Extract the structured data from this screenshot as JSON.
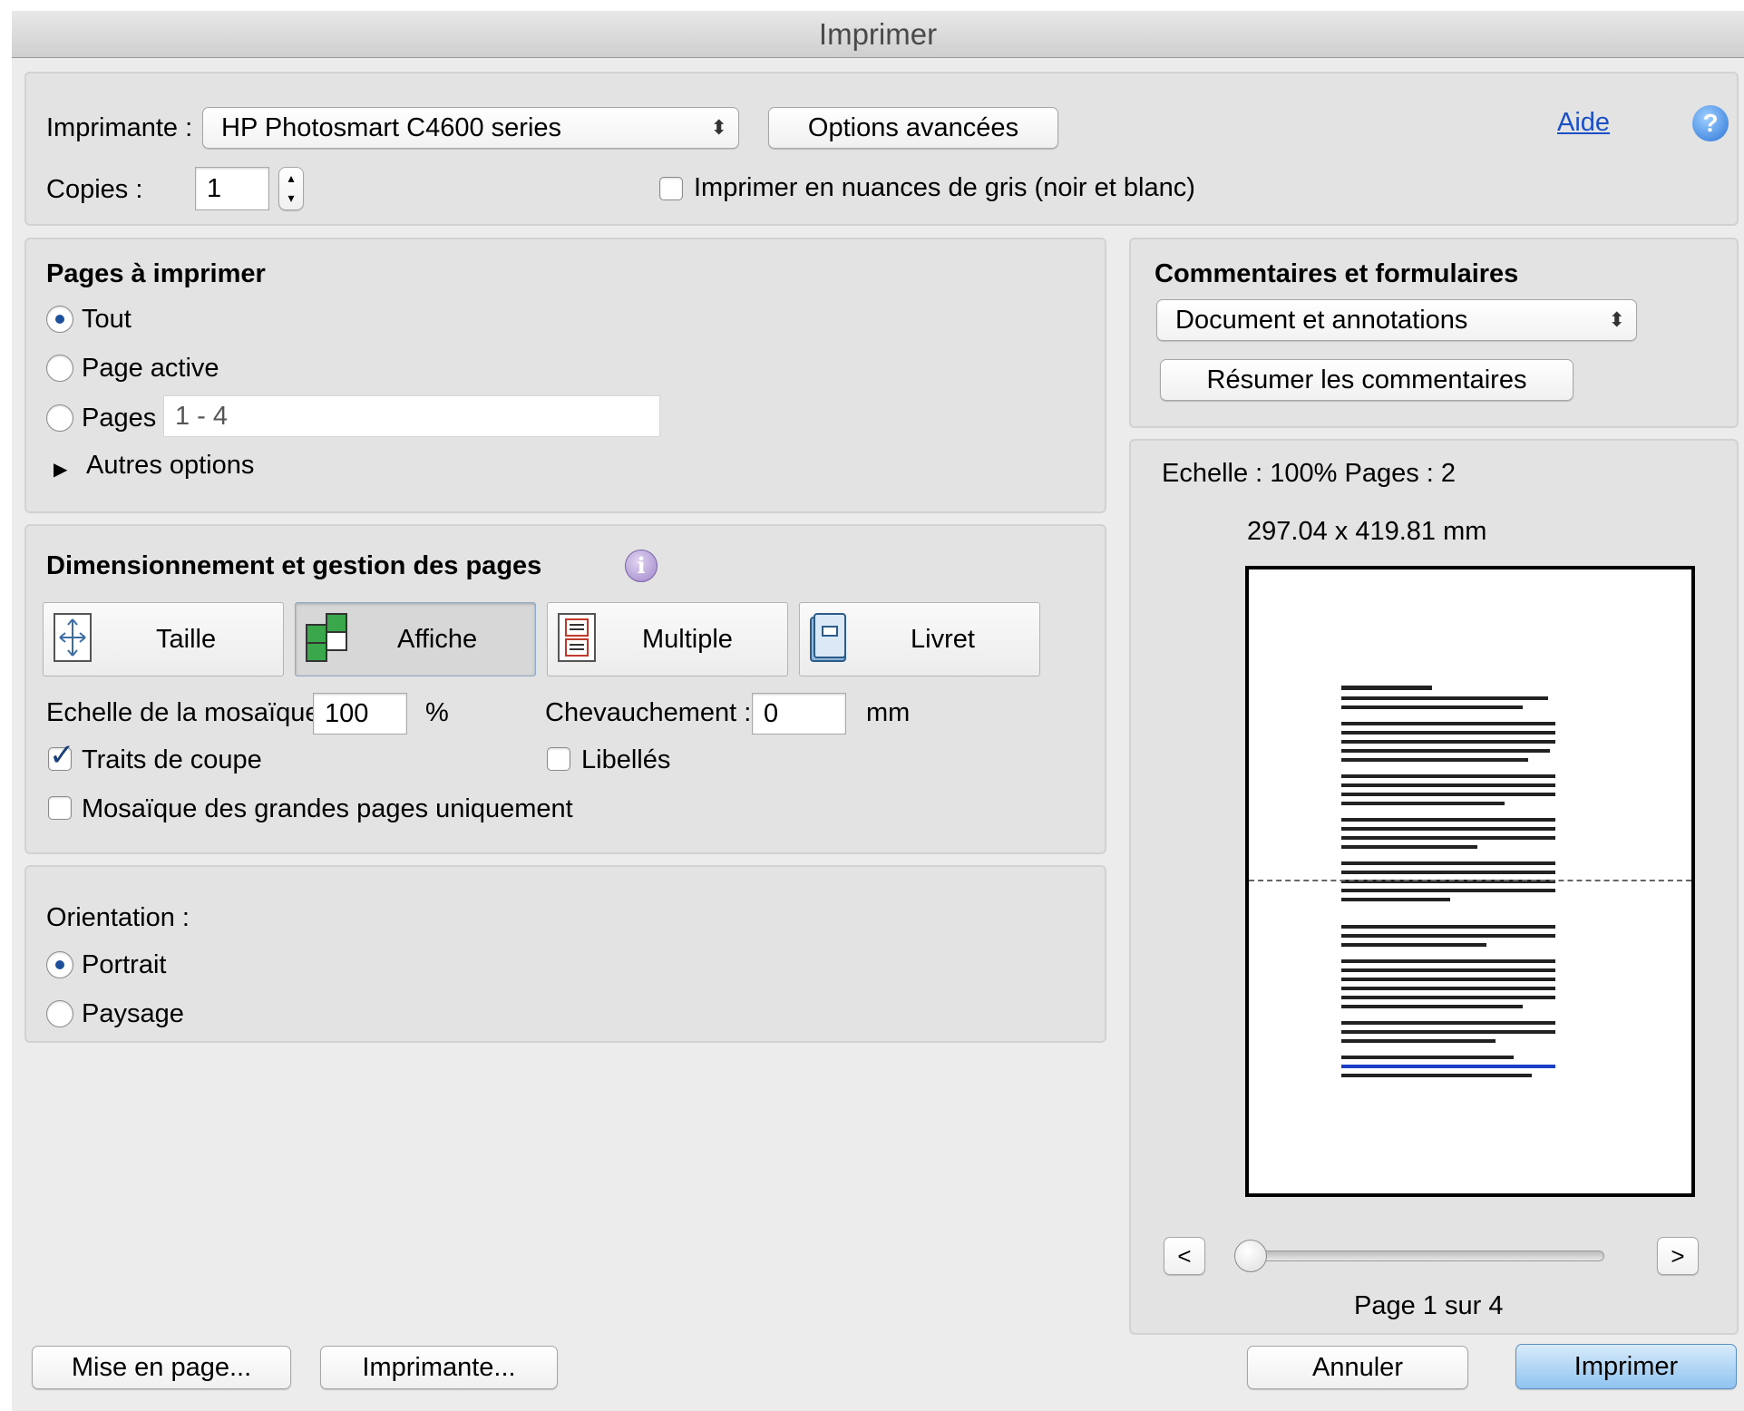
{
  "window": {
    "title": "Imprimer"
  },
  "top": {
    "printer_label": "Imprimante :",
    "printer_value": "HP Photosmart C4600 series",
    "advanced_options_label": "Options avancées",
    "help_link": "Aide",
    "help_icon_glyph": "?",
    "copies_label": "Copies :",
    "copies_value": "1",
    "grayscale_label": "Imprimer en nuances de gris (noir et blanc)",
    "grayscale_checked": false
  },
  "pages": {
    "title": "Pages à imprimer",
    "options": [
      {
        "label": "Tout",
        "selected": true
      },
      {
        "label": "Page active",
        "selected": false
      },
      {
        "label": "Pages",
        "selected": false
      }
    ],
    "range_value": "1 - 4",
    "more_options_label": "Autres options"
  },
  "sizing": {
    "title": "Dimensionnement et gestion des pages",
    "info_icon_glyph": "i",
    "tabs": [
      {
        "label": "Taille",
        "icon": "size-icon",
        "selected": false
      },
      {
        "label": "Affiche",
        "icon": "poster-icon",
        "selected": true
      },
      {
        "label": "Multiple",
        "icon": "multiple-icon",
        "selected": false
      },
      {
        "label": "Livret",
        "icon": "booklet-icon",
        "selected": false
      }
    ],
    "tile_scale_label": "Echelle de la mosaïque :",
    "tile_scale_value": "100",
    "tile_scale_unit": "%",
    "overlap_label": "Chevauchement :",
    "overlap_value": "0",
    "overlap_unit": "mm",
    "cut_marks_label": "Traits de coupe",
    "cut_marks_checked": true,
    "labels_label": "Libellés",
    "labels_checked": false,
    "large_pages_label": "Mosaïque des grandes pages uniquement",
    "large_pages_checked": false
  },
  "orientation": {
    "label": "Orientation :",
    "options": [
      {
        "label": "Portrait",
        "selected": true
      },
      {
        "label": "Paysage",
        "selected": false
      }
    ]
  },
  "comments": {
    "title": "Commentaires et formulaires",
    "select_value": "Document et annotations",
    "summarize_label": "Résumer les commentaires"
  },
  "preview": {
    "scale_text": "Echelle : 100% Pages : 2",
    "dimensions_text": "297.04 x 419.81 mm",
    "prev_label": "<",
    "next_label": ">",
    "slider_position": 0,
    "page_indicator": "Page 1 sur 4"
  },
  "footer": {
    "page_setup_label": "Mise en page...",
    "printer_label": "Imprimante...",
    "cancel_label": "Annuler",
    "print_label": "Imprimer"
  },
  "colors": {
    "window_bg": "#ececec",
    "panel_bg": "#e3e3e3",
    "accent_blue": "#1a4fc6",
    "primary_button": "#8fc3f0"
  }
}
